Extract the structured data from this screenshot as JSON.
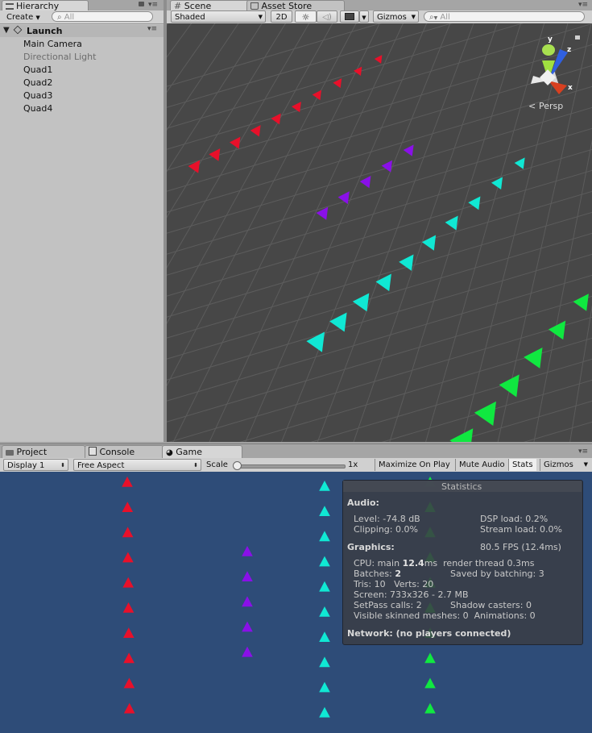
{
  "hierarchy": {
    "tab_label": "Hierarchy",
    "create_label": "Create",
    "search_placeholder": "All",
    "scene_name": "Launch",
    "items": [
      {
        "label": "Main Camera",
        "dimmed": false
      },
      {
        "label": "Directional Light",
        "dimmed": true
      },
      {
        "label": "Quad1",
        "dimmed": false
      },
      {
        "label": "Quad2",
        "dimmed": false
      },
      {
        "label": "Quad3",
        "dimmed": false
      },
      {
        "label": "Quad4",
        "dimmed": false
      }
    ]
  },
  "scene": {
    "tab_label": "Scene",
    "asset_store_tab": "Asset Store",
    "shading_mode": "Shaded",
    "mode_2d": "2D",
    "gizmos_label": "Gizmos",
    "search_placeholder": "All",
    "persp_label": "Persp",
    "axis_y": "y",
    "axis_z": "z",
    "axis_x": "x"
  },
  "bottom_tabs": {
    "project": "Project",
    "console": "Console",
    "game": "Game"
  },
  "game_toolbar": {
    "display": "Display 1",
    "aspect": "Free Aspect",
    "scale_label": "Scale",
    "scale_value": "1x",
    "scale_fraction": 0,
    "maximize": "Maximize On Play",
    "mute": "Mute Audio",
    "stats": "Stats",
    "gizmos": "Gizmos"
  },
  "statistics": {
    "title": "Statistics",
    "audio_header": "Audio:",
    "level": "Level: -74.8 dB",
    "clipping": "Clipping: 0.0%",
    "dsp_load": "DSP load: 0.2%",
    "stream_load": "Stream load: 0.0%",
    "graphics_header": "Graphics:",
    "fps": "80.5 FPS (12.4ms)",
    "cpu_prefix": "CPU: main ",
    "cpu_main": "12.4",
    "cpu_suffix": "ms  render thread 0.3ms",
    "batches_prefix": "Batches: ",
    "batches_value": "2",
    "saved_by_batching": "Saved by batching: 3",
    "tris_verts": "Tris: 10   Verts: 20",
    "screen": "Screen: 733x326 - 2.7 MB",
    "setpass": "SetPass calls: 2",
    "shadow_casters": "Shadow casters: 0",
    "visible_skinned": "Visible skinned meshes: 0  Animations: 0",
    "network": "Network: (no players connected)"
  },
  "colors": {
    "red": "#e8102a",
    "purple": "#8a10e8",
    "cyan": "#10e8d4",
    "green": "#10e840",
    "game_bg": "#2e4c78",
    "scene_bg": "#474747"
  }
}
